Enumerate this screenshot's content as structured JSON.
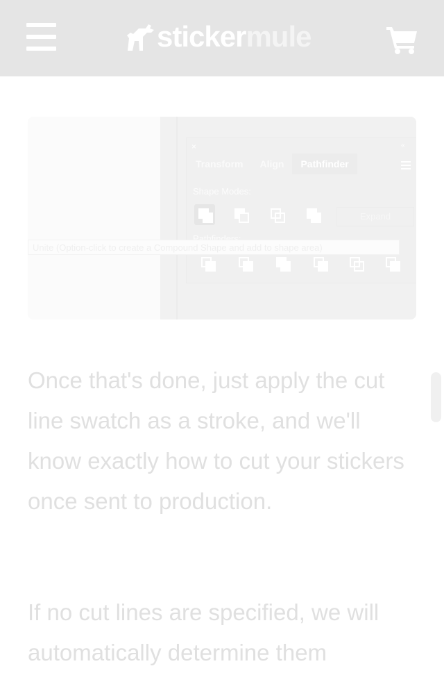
{
  "header": {
    "brand_part1": "sticker",
    "brand_part2": "mule"
  },
  "article": {
    "clipped_line": "p",
    "paragraph1": "Once that's done, just apply the cut line swatch as a stroke, and we'll know exactly how to cut your stickers once sent to production.",
    "paragraph2": "If no cut lines are specified, we will automatically determine them"
  },
  "screenshot": {
    "close": "×",
    "collapse": "‹‹",
    "tabs": [
      "Transform",
      "Align",
      "Pathfinder"
    ],
    "active_tab": "Pathfinder",
    "shape_modes_label": "Shape Modes:",
    "pathfinders_label": "Pathfinders:",
    "expand_label": "Expand",
    "tooltip": "Unite (Option-click to create a Compound Shape and add to shape area)"
  },
  "icons": {
    "menu": "hamburger-menu-icon",
    "logo": "mule-logo-icon",
    "cart": "shopping-cart-icon"
  },
  "colors": {
    "header_bg": "#e5e5e5",
    "text": "#e0e0e0"
  }
}
